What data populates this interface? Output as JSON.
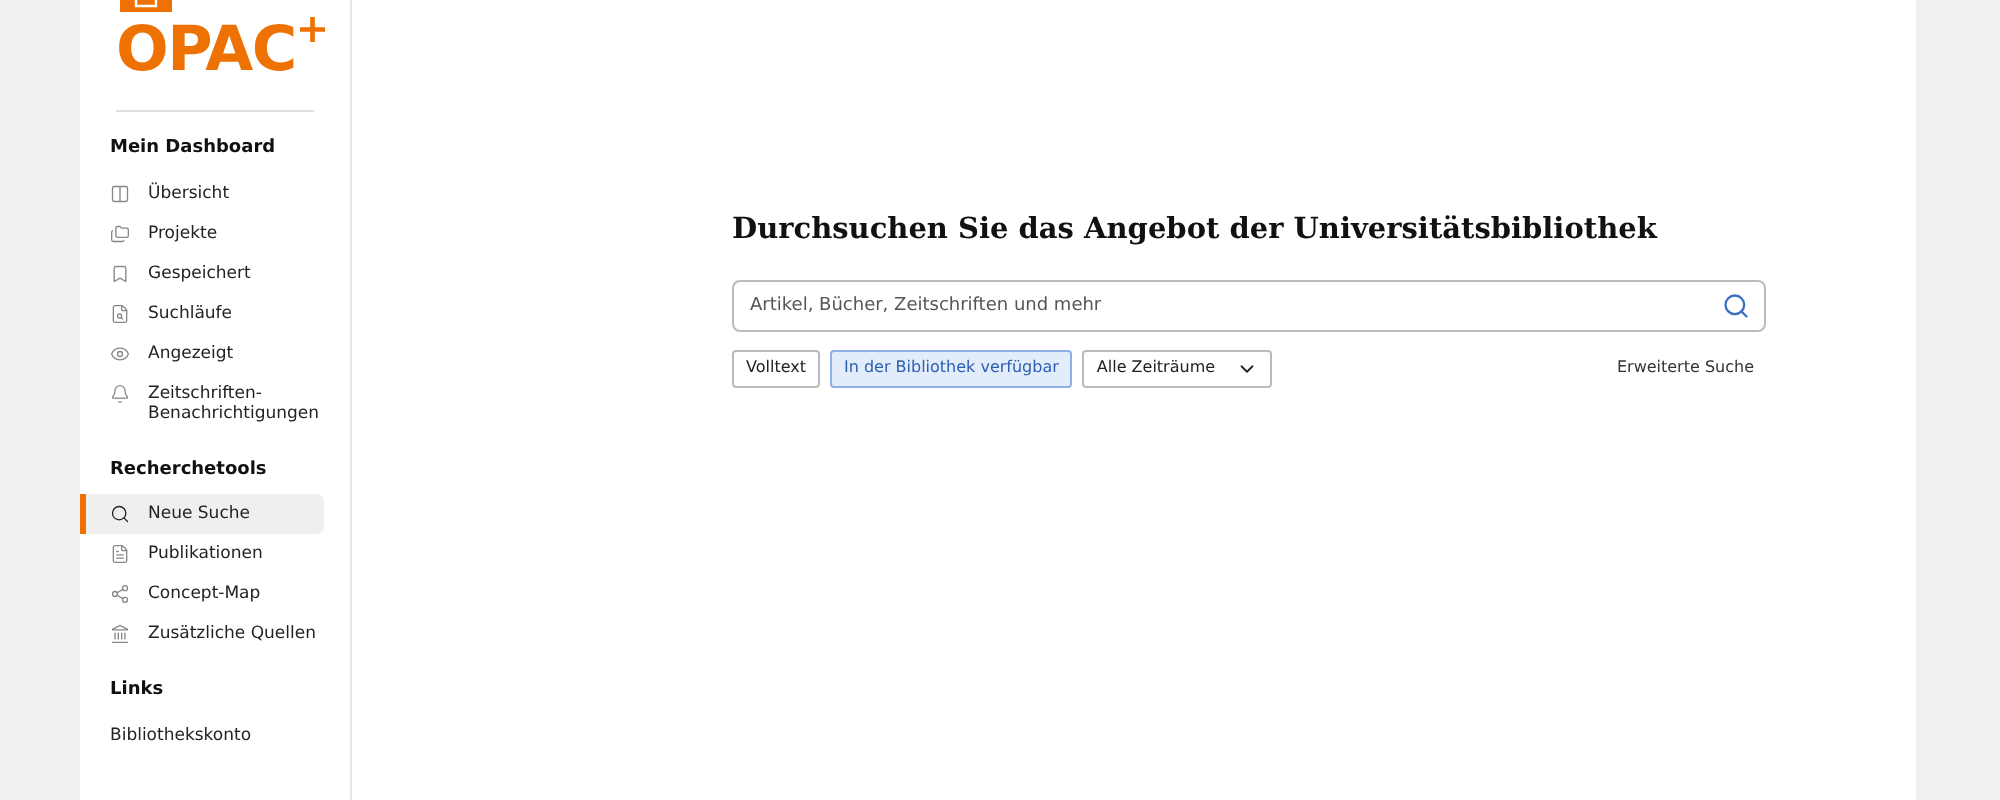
{
  "logo": {
    "text": "OPAC",
    "sup": "+"
  },
  "sidebar": {
    "sections": [
      {
        "title": "Mein Dashboard",
        "items": [
          {
            "label": "Übersicht",
            "selected": false
          },
          {
            "label": "Projekte",
            "selected": false
          },
          {
            "label": "Gespeichert",
            "selected": false
          },
          {
            "label": "Suchläufe",
            "selected": false
          },
          {
            "label": "Angezeigt",
            "selected": false
          },
          {
            "label": "Zeitschriften-\nBenachrichtigungen",
            "selected": false
          }
        ]
      },
      {
        "title": "Recherchetools",
        "items": [
          {
            "label": "Neue Suche",
            "selected": true
          },
          {
            "label": "Publikationen",
            "selected": false
          },
          {
            "label": "Concept-Map",
            "selected": false
          },
          {
            "label": "Zusätzliche Quellen",
            "selected": false
          }
        ]
      },
      {
        "title": "Links",
        "items": [
          {
            "label": "Bibliothekskonto",
            "selected": false
          }
        ]
      }
    ]
  },
  "main": {
    "heading": "Durchsuchen Sie das Angebot der Universitätsbibliothek",
    "search": {
      "placeholder": "Artikel, Bücher, Zeitschriften und mehr"
    },
    "filters": [
      {
        "label": "Volltext",
        "kind": "toggle",
        "selected": false
      },
      {
        "label": "In der Bibliothek verfügbar",
        "kind": "toggle",
        "selected": true
      },
      {
        "label": "Alle Zeiträume",
        "kind": "dropdown"
      }
    ],
    "advanced_link": "Erweiterte Suche"
  }
}
